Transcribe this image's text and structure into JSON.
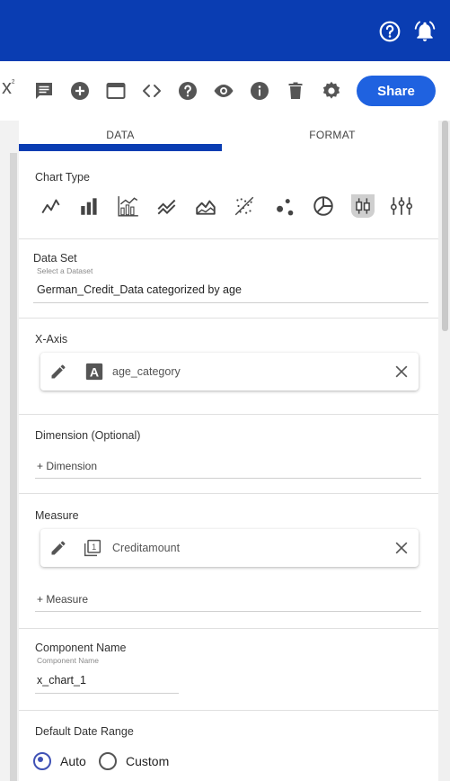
{
  "topbar": {
    "bg": "#0a3db2",
    "help_icon": "help-circle-icon",
    "notify_icon": "bell-alert-icon"
  },
  "toolbar": {
    "formula_label": "x",
    "formula_sup": "²",
    "share_label": "Share",
    "share_color": "#1f62e0",
    "icons": [
      "comment-icon",
      "add-circle-icon",
      "window-icon",
      "code-icon",
      "help-icon",
      "visibility-icon",
      "info-icon",
      "delete-icon",
      "settings-icon"
    ]
  },
  "tabs": [
    {
      "label": "DATA",
      "active": true
    },
    {
      "label": "FORMAT",
      "active": false
    }
  ],
  "chart_type": {
    "label": "Chart Type",
    "icons": [
      "line-chart-icon",
      "bar-chart-icon",
      "bar-line-chart-icon",
      "multi-line-chart-icon",
      "area-chart-icon",
      "scatter-trend-icon",
      "bubble-chart-icon",
      "pie-chart-icon",
      "candlestick-chart-icon",
      "box-plot-icon"
    ],
    "selected": "candlestick-chart-icon"
  },
  "dataset": {
    "label": "Data Set",
    "placeholder": "Select a Dataset",
    "value": "German_Credit_Data categorized by age"
  },
  "xaxis": {
    "label": "X-Axis",
    "field": "age_category",
    "type_letter": "A"
  },
  "dimension": {
    "label": "Dimension (Optional)",
    "add_label": "+ Dimension"
  },
  "measure": {
    "label": "Measure",
    "field": "Creditamount",
    "type_number": "1",
    "add_label": "+ Measure"
  },
  "component": {
    "label": "Component Name",
    "placeholder": "Component Name",
    "value": "x_chart_1"
  },
  "date_range": {
    "label": "Default Date Range",
    "options": [
      "Auto",
      "Custom"
    ],
    "selected": "Auto"
  }
}
